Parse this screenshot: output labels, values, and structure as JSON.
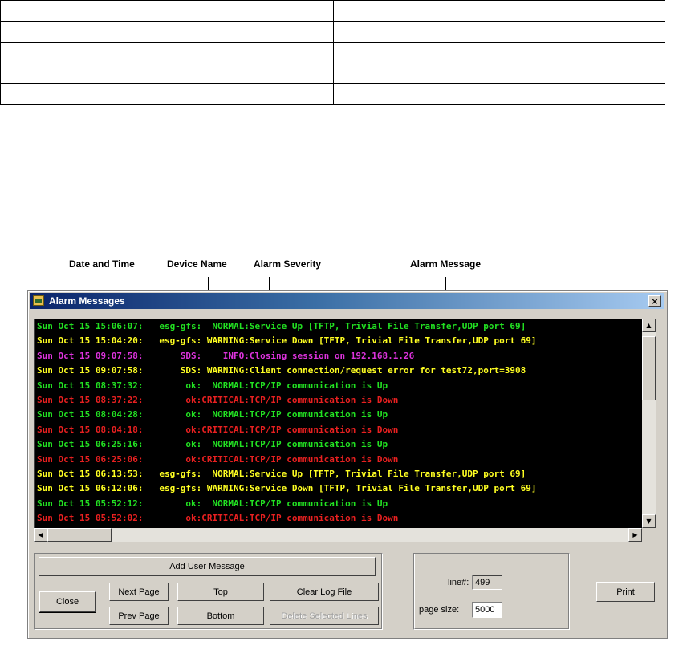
{
  "callouts": {
    "date_time": "Date and Time",
    "device_name": "Device Name",
    "alarm_severity": "Alarm Severity",
    "alarm_message": "Alarm Message"
  },
  "window": {
    "title": "Alarm Messages",
    "close_label": "×"
  },
  "log_lines": [
    {
      "text": "Sun Oct 15 15:06:07:   esg-gfs:  NORMAL:Service Up [TFTP, Trivial File Transfer,UDP port 69]",
      "color": "#22e022"
    },
    {
      "text": "Sun Oct 15 15:04:20:   esg-gfs: WARNING:Service Down [TFTP, Trivial File Transfer,UDP port 69]",
      "color": "#ffff22"
    },
    {
      "text": "Sun Oct 15 09:07:58:       SDS:    INFO:Closing session on 192.168.1.26",
      "color": "#dd33dd"
    },
    {
      "text": "Sun Oct 15 09:07:58:       SDS: WARNING:Client connection/request error for test72,port=3908",
      "color": "#ffff22"
    },
    {
      "text": "Sun Oct 15 08:37:32:        ok:  NORMAL:TCP/IP communication is Up",
      "color": "#22e022"
    },
    {
      "text": "Sun Oct 15 08:37:22:        ok:CRITICAL:TCP/IP communication is Down",
      "color": "#e82020"
    },
    {
      "text": "Sun Oct 15 08:04:28:        ok:  NORMAL:TCP/IP communication is Up",
      "color": "#22e022"
    },
    {
      "text": "Sun Oct 15 08:04:18:        ok:CRITICAL:TCP/IP communication is Down",
      "color": "#e82020"
    },
    {
      "text": "Sun Oct 15 06:25:16:        ok:  NORMAL:TCP/IP communication is Up",
      "color": "#22e022"
    },
    {
      "text": "Sun Oct 15 06:25:06:        ok:CRITICAL:TCP/IP communication is Down",
      "color": "#e82020"
    },
    {
      "text": "Sun Oct 15 06:13:53:   esg-gfs:  NORMAL:Service Up [TFTP, Trivial File Transfer,UDP port 69]",
      "color": "#ffff22"
    },
    {
      "text": "Sun Oct 15 06:12:06:   esg-gfs: WARNING:Service Down [TFTP, Trivial File Transfer,UDP port 69]",
      "color": "#ffff22"
    },
    {
      "text": "Sun Oct 15 05:52:12:        ok:  NORMAL:TCP/IP communication is Up",
      "color": "#22e022"
    },
    {
      "text": "Sun Oct 15 05:52:02:        ok:CRITICAL:TCP/IP communication is Down",
      "color": "#e82020"
    }
  ],
  "buttons": {
    "add_user_message": "Add User Message",
    "close": "Close",
    "next_page": "Next Page",
    "prev_page": "Prev Page",
    "top": "Top",
    "bottom": "Bottom",
    "clear_log_file": "Clear Log File",
    "delete_selected_lines": "Delete Selected Lines",
    "print": "Print"
  },
  "paging": {
    "line_label": "line#:",
    "line_value": "499",
    "page_size_label": "page size:",
    "page_size_value": "5000"
  }
}
